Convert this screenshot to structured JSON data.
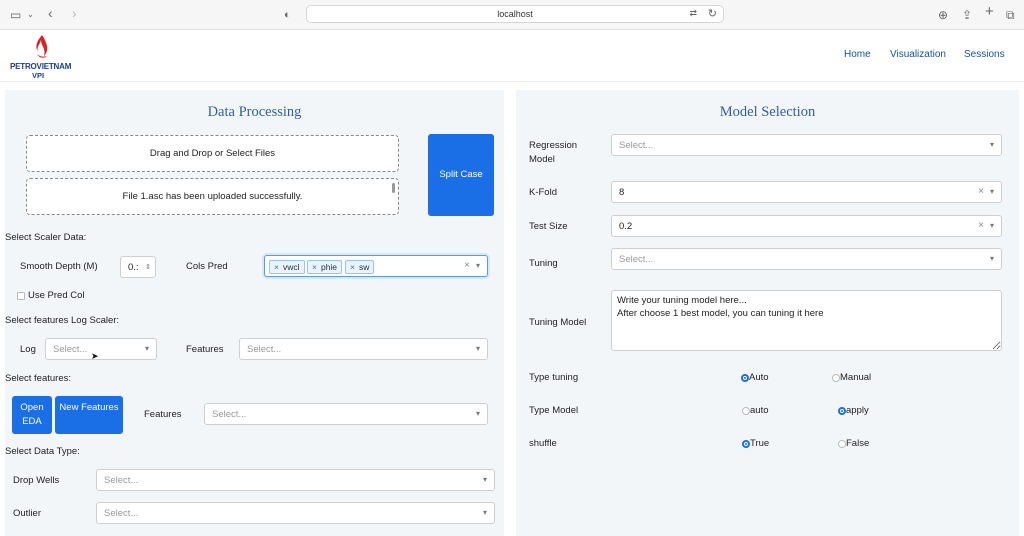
{
  "browser": {
    "url": "localhost"
  },
  "nav": {
    "home": "Home",
    "visualization": "Visualization",
    "sessions": "Sessions"
  },
  "logo": {
    "line1": "PETROVIETNAM",
    "line2": "VPI"
  },
  "colors": {
    "accent": "#1a6ee6",
    "title": "#2f5fa8",
    "panel_bg": "#f3f6f9",
    "logo_red": "#d7262b",
    "logo_blue": "#1b3f8f"
  },
  "data_processing": {
    "title": "Data Processing",
    "dropzone_label": "Drag and Drop or Select Files",
    "upload_status": "File 1.asc has been uploaded successfully.",
    "split_case_button": "Split Case",
    "select_scaler_label": "Select Scaler Data:",
    "smooth_depth_label": "Smooth Depth (M)",
    "smooth_depth_value": "0.:",
    "cols_pred_label": "Cols Pred",
    "cols_pred_tags": [
      "vwcl",
      "phie",
      "sw"
    ],
    "use_pred_col_label": "Use Pred Col",
    "log_scaler_heading": "Select features Log Scaler:",
    "log_label": "Log",
    "log_placeholder": "Select...",
    "features_label": "Features",
    "features_placeholder": "Select...",
    "select_features_heading": "Select features:",
    "open_eda_button": "Open EDA",
    "new_features_button": "New Features",
    "features2_label": "Features",
    "features2_placeholder": "Select...",
    "data_type_heading": "Select Data Type:",
    "drop_wells_label": "Drop Wells",
    "drop_wells_placeholder": "Select...",
    "outlier_label": "Outlier",
    "outlier_placeholder": "Select..."
  },
  "model_selection": {
    "title": "Model Selection",
    "regression_label": "Regression Model",
    "regression_placeholder": "Select...",
    "kfold_label": "K-Fold",
    "kfold_value": "8",
    "test_size_label": "Test Size",
    "test_size_value": "0.2",
    "tuning_label": "Tuning",
    "tuning_placeholder": "Select...",
    "tuning_model_label": "Tuning Model",
    "tuning_model_text": "Write your tuning model here...\nAfter choose 1 best model, you can tuning it here",
    "type_tuning_label": "Type tuning",
    "type_tuning_options": [
      "Auto",
      "Manual"
    ],
    "type_tuning_selected": "Auto",
    "type_model_label": "Type Model",
    "type_model_options": [
      "auto",
      "apply"
    ],
    "type_model_selected": "apply",
    "shuffle_label": "shuffle",
    "shuffle_options": [
      "True",
      "False"
    ],
    "shuffle_selected": "True"
  }
}
